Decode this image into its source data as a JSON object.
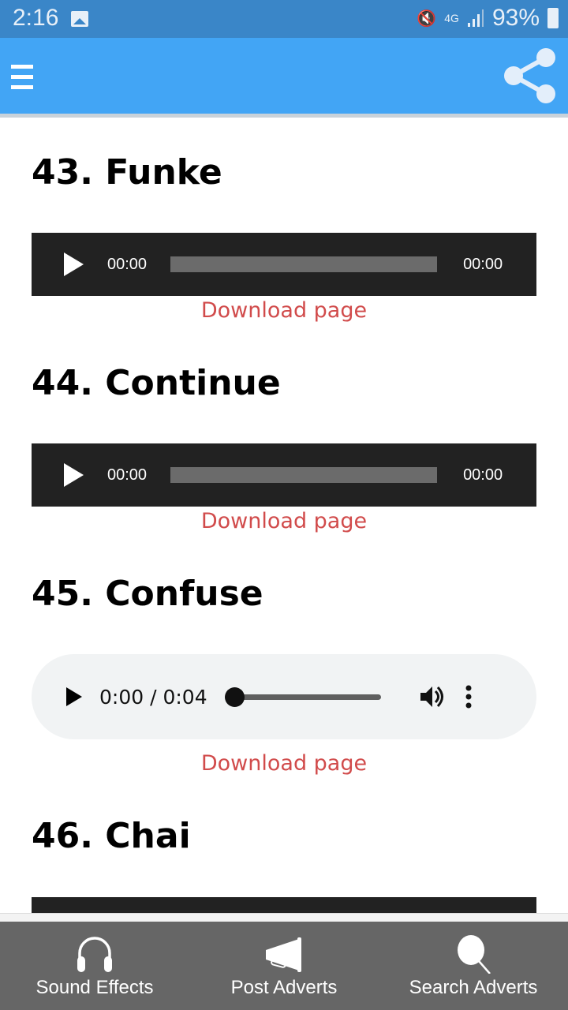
{
  "status_bar": {
    "time": "2:16",
    "battery": "93%",
    "network": "4G",
    "icons": [
      "image-icon",
      "vibrate-mute-icon",
      "4g-data-icon",
      "signal-icon",
      "battery-icon"
    ]
  },
  "app_bar": {
    "menu_icon": "hamburger-menu-icon",
    "share_icon": "share-icon"
  },
  "items": [
    {
      "title": "43. Funke",
      "player": {
        "style": "dark",
        "current": "00:00",
        "duration": "00:00",
        "progress": 0
      },
      "download_label": "Download page"
    },
    {
      "title": "44. Continue",
      "player": {
        "style": "dark",
        "current": "00:00",
        "duration": "00:00",
        "progress": 0
      },
      "download_label": "Download page"
    },
    {
      "title": "45. Confuse",
      "player": {
        "style": "native",
        "time": "0:00 / 0:04",
        "progress": 0
      },
      "download_label": "Download page"
    },
    {
      "title": "46. Chai",
      "player": {
        "style": "dark"
      }
    }
  ],
  "bottom_nav": [
    {
      "label": "Sound Effects",
      "icon": "headphones-icon"
    },
    {
      "label": "Post Adverts",
      "icon": "megaphone-icon"
    },
    {
      "label": "Search Adverts",
      "icon": "search-icon"
    }
  ],
  "colors": {
    "status_bar": "#3a86c8",
    "app_bar": "#42a5f5",
    "link": "#d14b4b",
    "player_dark": "#222222",
    "bottom_nav": "#666666"
  }
}
